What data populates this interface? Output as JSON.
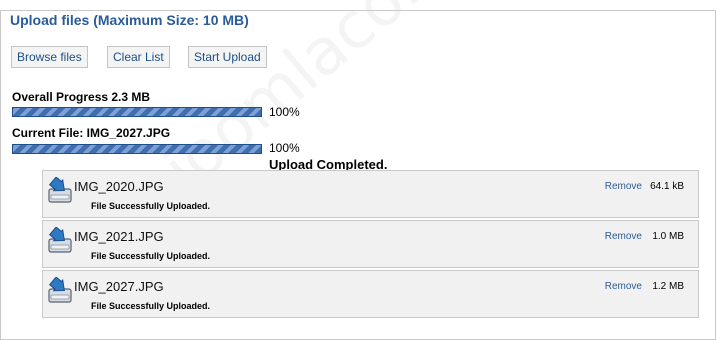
{
  "panel": {
    "title": "Upload files (Maximum  Size: 10 MB)"
  },
  "toolbar": {
    "browse_label": "Browse files",
    "clear_label": "Clear List",
    "start_label": "Start Upload"
  },
  "overall": {
    "label": "Overall Progress 2.3 MB",
    "percent_text": "100%",
    "progress_fraction": 1.0
  },
  "current": {
    "label": "Current File: IMG_2027.JPG",
    "percent_text": "100%",
    "progress_fraction": 1.0
  },
  "status_message": "Upload Completed.",
  "files": [
    {
      "name": "IMG_2020.JPG",
      "status": "File Successfully Uploaded.",
      "remove_label": "Remove",
      "size": "64.1 kB"
    },
    {
      "name": "IMG_2021.JPG",
      "status": "File Successfully Uploaded.",
      "remove_label": "Remove",
      "size": "1.0 MB"
    },
    {
      "name": "IMG_2027.JPG",
      "status": "File Successfully Uploaded.",
      "remove_label": "Remove",
      "size": "1.2 MB"
    }
  ],
  "watermark": "joomlacorner.com",
  "colors": {
    "accent": "#2a5c9a",
    "progress_fill": "#3f6fb0",
    "item_bg": "#f1f1f1"
  },
  "icons": {
    "file_item": "upload-arrow-icon"
  }
}
